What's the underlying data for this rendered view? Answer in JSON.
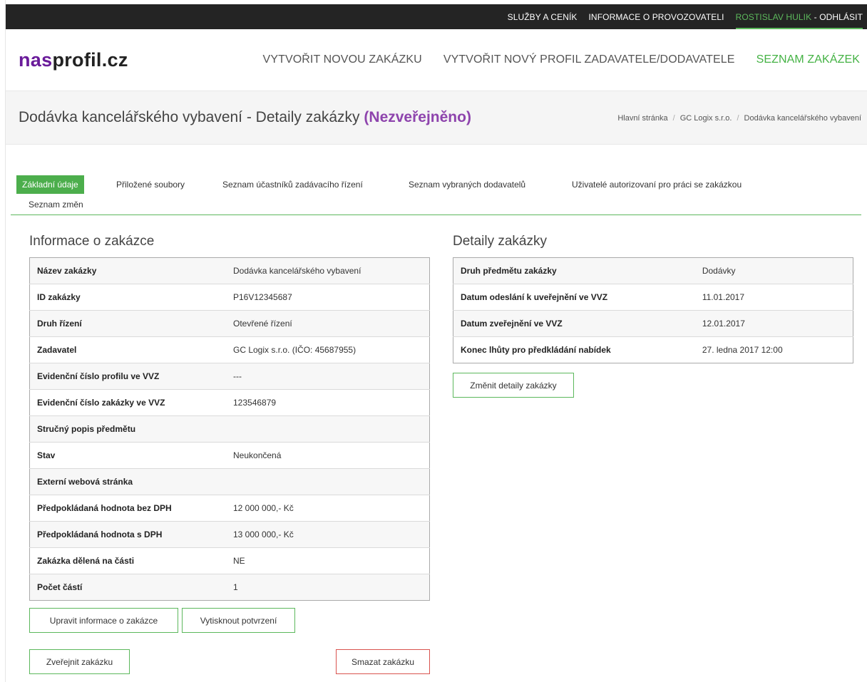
{
  "topbar": {
    "services": "SLUŽBY A CENÍK",
    "operator_info": "INFORMACE O PROVOZOVATELI",
    "user_name": "ROSTISLAV HULIK",
    "separator": " - ",
    "logout": "ODHLÁSIT"
  },
  "logo": {
    "part1": "nas",
    "part2": "profil.cz"
  },
  "nav": {
    "create_contract": "VYTVOŘIT NOVOU ZAKÁZKU",
    "create_profile": "VYTVOŘIT NOVÝ PROFIL ZADAVATELE/DODAVATELE",
    "contract_list": "SEZNAM ZAKÁZEK"
  },
  "page": {
    "title": "Dodávka kancelářského vybavení - Detaily zakázky",
    "status": "(Nezveřejněno)"
  },
  "breadcrumb": {
    "home": "Hlavní stránka",
    "company": "GC Logix s.r.o.",
    "current": "Dodávka kancelářského vybavení",
    "sep": "/"
  },
  "tabs": {
    "basic": "Základní údaje",
    "files": "Přiložené soubory",
    "participants": "Seznam účastníků zadávacího řízení",
    "suppliers": "Seznam vybraných dodavatelů",
    "users": "Uživatelé autorizovaní pro práci se zakázkou",
    "changes": "Seznam změn"
  },
  "info": {
    "title": "Informace o zakázce",
    "rows": [
      {
        "label": "Název zakázky",
        "value": "Dodávka kancelářského vybavení"
      },
      {
        "label": "ID zakázky",
        "value": "P16V12345687"
      },
      {
        "label": "Druh řízení",
        "value": "Otevřené řízení"
      },
      {
        "label": "Zadavatel",
        "value": "GC Logix s.r.o. (IČO: 45687955)"
      },
      {
        "label": "Evidenční číslo profilu ve VVZ",
        "value": "---"
      },
      {
        "label": "Evidenční číslo zakázky ve VVZ",
        "value": "123546879"
      },
      {
        "label": "Stručný popis předmětu",
        "value": ""
      },
      {
        "label": "Stav",
        "value": "Neukončená"
      },
      {
        "label": "Externí webová stránka",
        "value": ""
      },
      {
        "label": "Předpokládaná hodnota bez DPH",
        "value": "12 000 000,- Kč"
      },
      {
        "label": "Předpokládaná hodnota s DPH",
        "value": "13 000 000,- Kč"
      },
      {
        "label": "Zakázka dělená na části",
        "value": "NE"
      },
      {
        "label": "Počet částí",
        "value": "1"
      }
    ],
    "edit_button": "Upravit informace o zakázce",
    "print_button": "Vytisknout potvrzení",
    "publish_button": "Zveřejnit zakázku",
    "delete_button": "Smazat zakázku"
  },
  "details": {
    "title": "Detaily zakázky",
    "rows": [
      {
        "label": "Druh předmětu zakázky",
        "value": "Dodávky"
      },
      {
        "label": "Datum odeslání k uveřejnění ve VVZ",
        "value": "11.01.2017"
      },
      {
        "label": "Datum zveřejnění ve VVZ",
        "value": "12.01.2017"
      },
      {
        "label": "Konec lhůty pro předkládání nabídek",
        "value": "27. ledna 2017 12:00"
      }
    ],
    "change_button": "Změnit detaily zakázky"
  },
  "colors": {
    "accent_green": "#5cb85c",
    "brand_purple": "#6a1b9a",
    "status_purple": "#8e44ad",
    "danger_red": "#d9534f",
    "topbar_bg": "#242424"
  }
}
